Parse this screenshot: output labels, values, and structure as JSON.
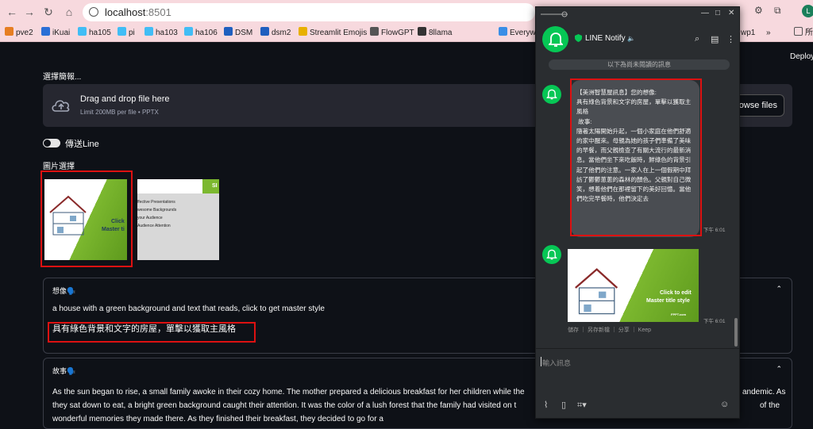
{
  "browser": {
    "url_host": "localhost",
    "url_port": ":8501",
    "bookmarks": [
      "pve2",
      "iKuai",
      "ha105",
      "pi",
      "ha103",
      "ha106",
      "DSM",
      "dsm2",
      "Streamlit Emojis",
      "FlowGPT",
      "8llama",
      "Everywl",
      "wp1",
      "所"
    ],
    "profile_initial": "L"
  },
  "app": {
    "deploy_label": "Deploy",
    "uploader_label": "選擇簡報...",
    "drop_title": "Drag and drop file here",
    "drop_sub": "Limit 200MB per file • PPTX",
    "browse_label": "rowse files",
    "toggle_label": "傳送Line",
    "image_select_label": "圖片選擇",
    "slide1": {
      "line1": "Click",
      "line2": "Master ti"
    },
    "slide2": {
      "tag": "SI",
      "lines": [
        "ffective Presentations",
        "wesome Backgrounds",
        "your Audience",
        "Audience Attention"
      ]
    },
    "imagine": {
      "title": "想像🗣️",
      "english": "a house with a green background and text that reads, click to get master style",
      "chinese": "具有綠色背景和文字的房屋，單擊以獲取主風格"
    },
    "story": {
      "title": "故事🗣️",
      "line1": "As the sun began to rise, a small family awoke in their cozy home. The mother prepared a delicious breakfast for her children while the",
      "line1_end": "andemic. As",
      "line2": "they sat down to eat, a bright green background caught their attention. It was the color of a lush forest that the family had visited on t",
      "line2_end": "of the",
      "line3": "wonderful memories they made there. As they finished their breakfast, they decided to go for a"
    }
  },
  "line": {
    "chat_name": "LINE Notify",
    "mute_icon": "🔈",
    "unread_notice": "以下為尚未閱讀的訊息",
    "message_text": "【美洲智慧屋訊息】您的想像:\n具有綠色背景和文字的房屋，單擊以獲取主風格\n 故事:\n隨著太陽開始升起，一個小家庭在他們舒適的家中醒來。母親為她的孩子們準備了美味的早餐，而父親檢查了有關大流行的最新消息。當他們坐下來吃飯時，鮮綠色的背景引起了他們的注意。一家人在上一個假期中拜訪了鬱鬱蔥蔥的森林的顏色。父親對自己微笑，想着他們在那裡留下的美好回憶。當他們吃完早餐時，他們決定去",
    "msg_time": "下午 6:01",
    "img_time": "下午 6:01",
    "img_caption1": "Click to edit",
    "img_caption2": "Master title style",
    "img_footer": "FPPT.com",
    "img_actions": "儲存 ｜ 另存新檔 ｜ 分享 ｜ Keep",
    "input_placeholder": "輸入訊息"
  }
}
